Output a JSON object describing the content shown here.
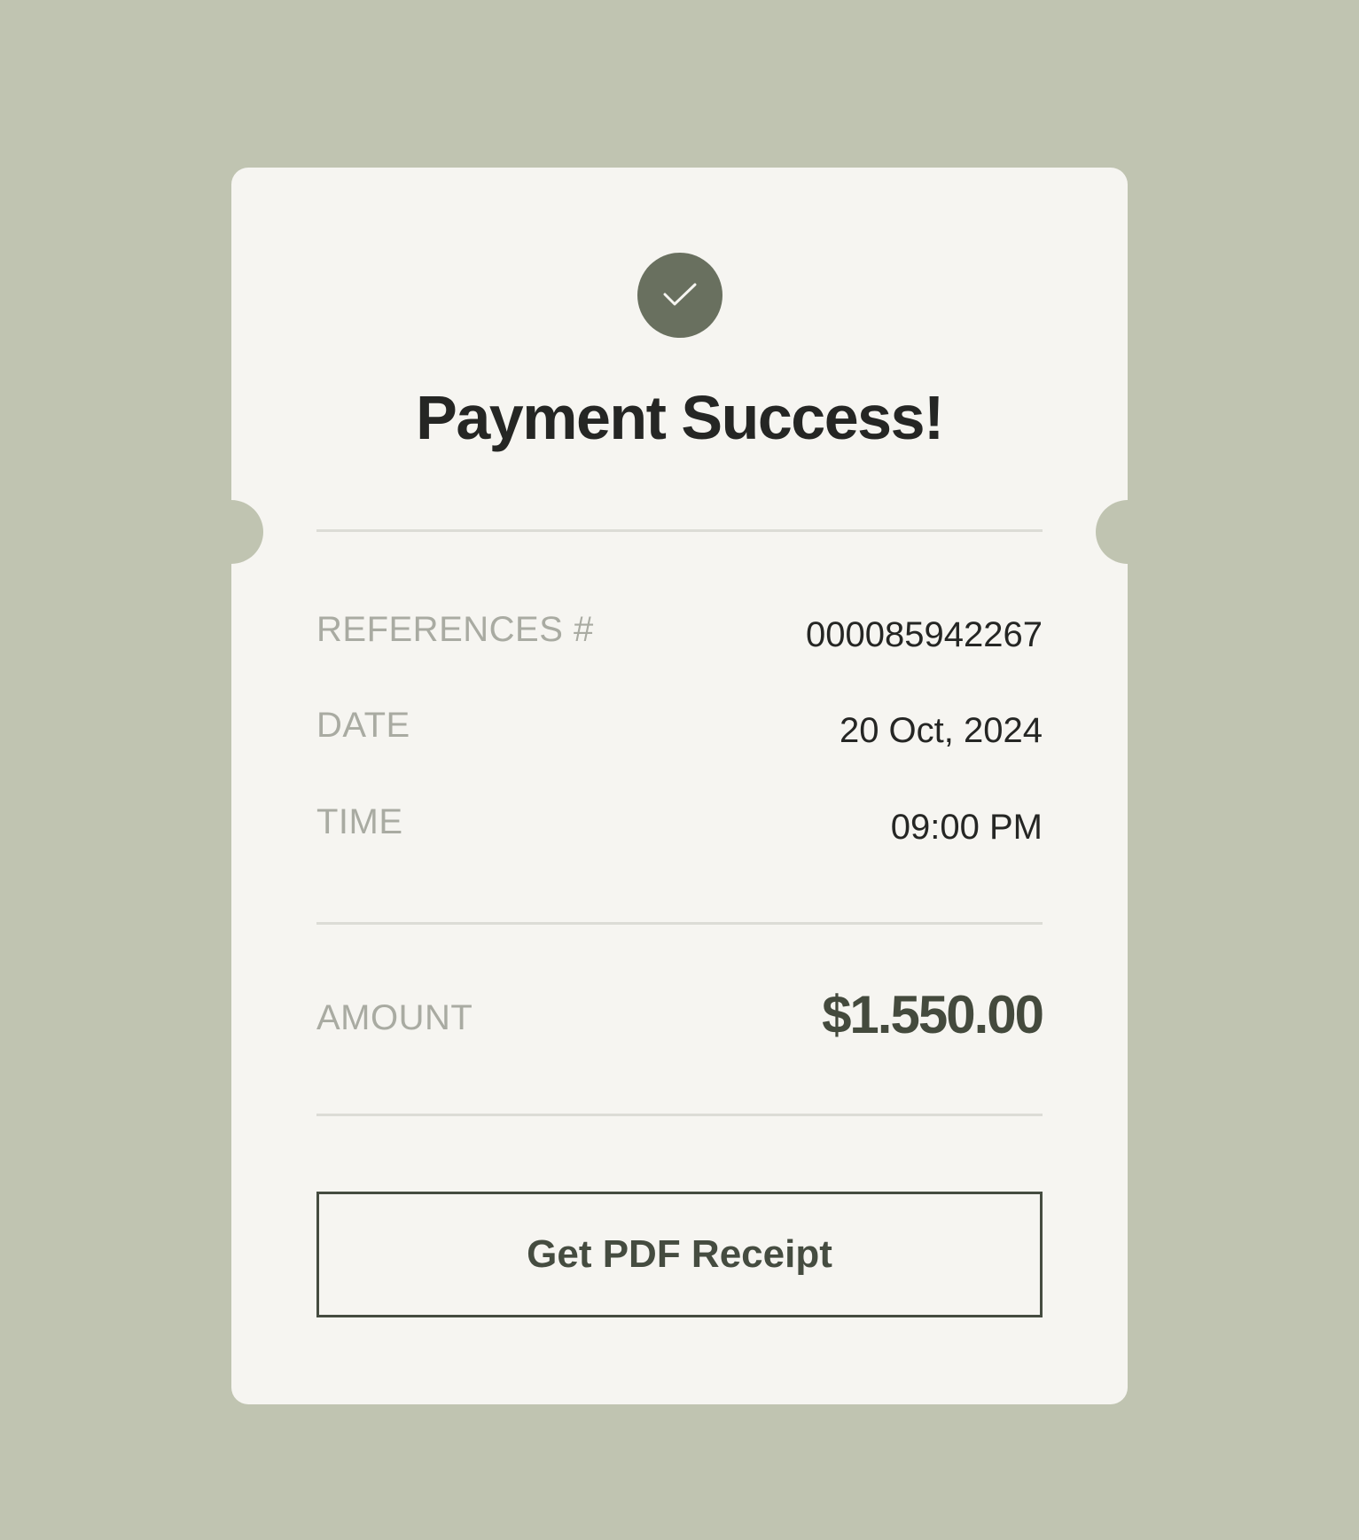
{
  "receipt": {
    "status_icon": "checkmark-icon",
    "title": "Payment Success!",
    "details": [
      {
        "label": "REFERENCES #",
        "value": "000085942267"
      },
      {
        "label": "DATE",
        "value": "20 Oct, 2024"
      },
      {
        "label": "TIME",
        "value": "09:00 PM"
      }
    ],
    "amount": {
      "label": "AMOUNT",
      "value": "$1.550.00"
    },
    "button_label": "Get PDF Receipt"
  },
  "colors": {
    "background": "#c0c4b1",
    "card": "#f6f5f1",
    "accent": "#69705f",
    "accent_dark": "#454c40",
    "label_text": "#a9aba2",
    "value_text": "#252624"
  }
}
